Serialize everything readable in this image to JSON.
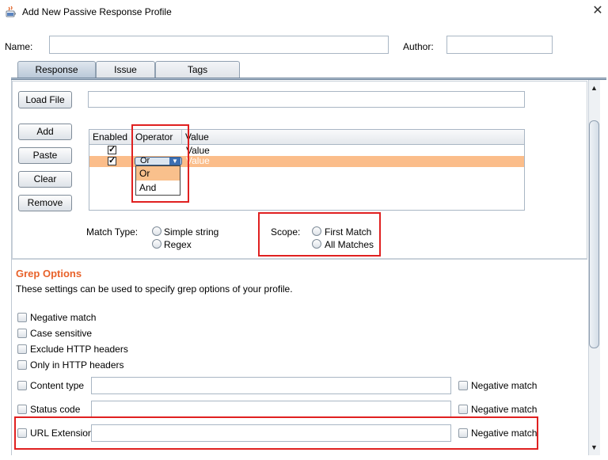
{
  "window": {
    "title": "Add New Passive Response Profile",
    "close_glyph": "✕"
  },
  "fields": {
    "name_label": "Name:",
    "name_value": "",
    "author_label": "Author:",
    "author_value": ""
  },
  "tabs": [
    {
      "label": "Response",
      "active": true
    },
    {
      "label": "Issue",
      "active": false
    },
    {
      "label": "Tags",
      "active": false
    }
  ],
  "response": {
    "load_file_label": "Load File",
    "load_file_path": "",
    "buttons": {
      "add": "Add",
      "paste": "Paste",
      "clear": "Clear",
      "remove": "Remove"
    },
    "table": {
      "columns": [
        "Enabled",
        "Operator",
        "Value"
      ],
      "rows": [
        {
          "enabled": true,
          "operator": "",
          "value": "Value",
          "selected": false
        },
        {
          "enabled": true,
          "operator": "Or",
          "value": "Value",
          "selected": true
        }
      ]
    },
    "operator_dropdown": {
      "current": "Or",
      "options": [
        "Or",
        "And"
      ],
      "highlighted": "Or"
    },
    "match_type": {
      "label": "Match Type:",
      "options": [
        "Simple string",
        "Regex"
      ]
    },
    "scope": {
      "label": "Scope:",
      "options": [
        "First Match",
        "All Matches"
      ]
    }
  },
  "grep": {
    "title": "Grep Options",
    "description": "These settings can be used to specify grep options of your profile.",
    "checkboxes": [
      "Negative match",
      "Case sensitive",
      "Exclude HTTP headers",
      "Only in HTTP headers"
    ],
    "filters": [
      {
        "label": "Content type",
        "value": "",
        "negative_label": "Negative match"
      },
      {
        "label": "Status code",
        "value": "",
        "negative_label": "Negative match"
      },
      {
        "label": "URL Extension",
        "value": "",
        "negative_label": "Negative match"
      }
    ]
  },
  "colors": {
    "accent_orange": "#e8622a",
    "highlight_red": "#e02020",
    "selected_row": "#fbbd8a",
    "dropdown_selected": "#f9c08c"
  },
  "icons": {
    "app": "java-cup-icon",
    "close": "close-icon",
    "scroll_up": "triangle-up-icon",
    "scroll_down": "triangle-down-icon"
  }
}
